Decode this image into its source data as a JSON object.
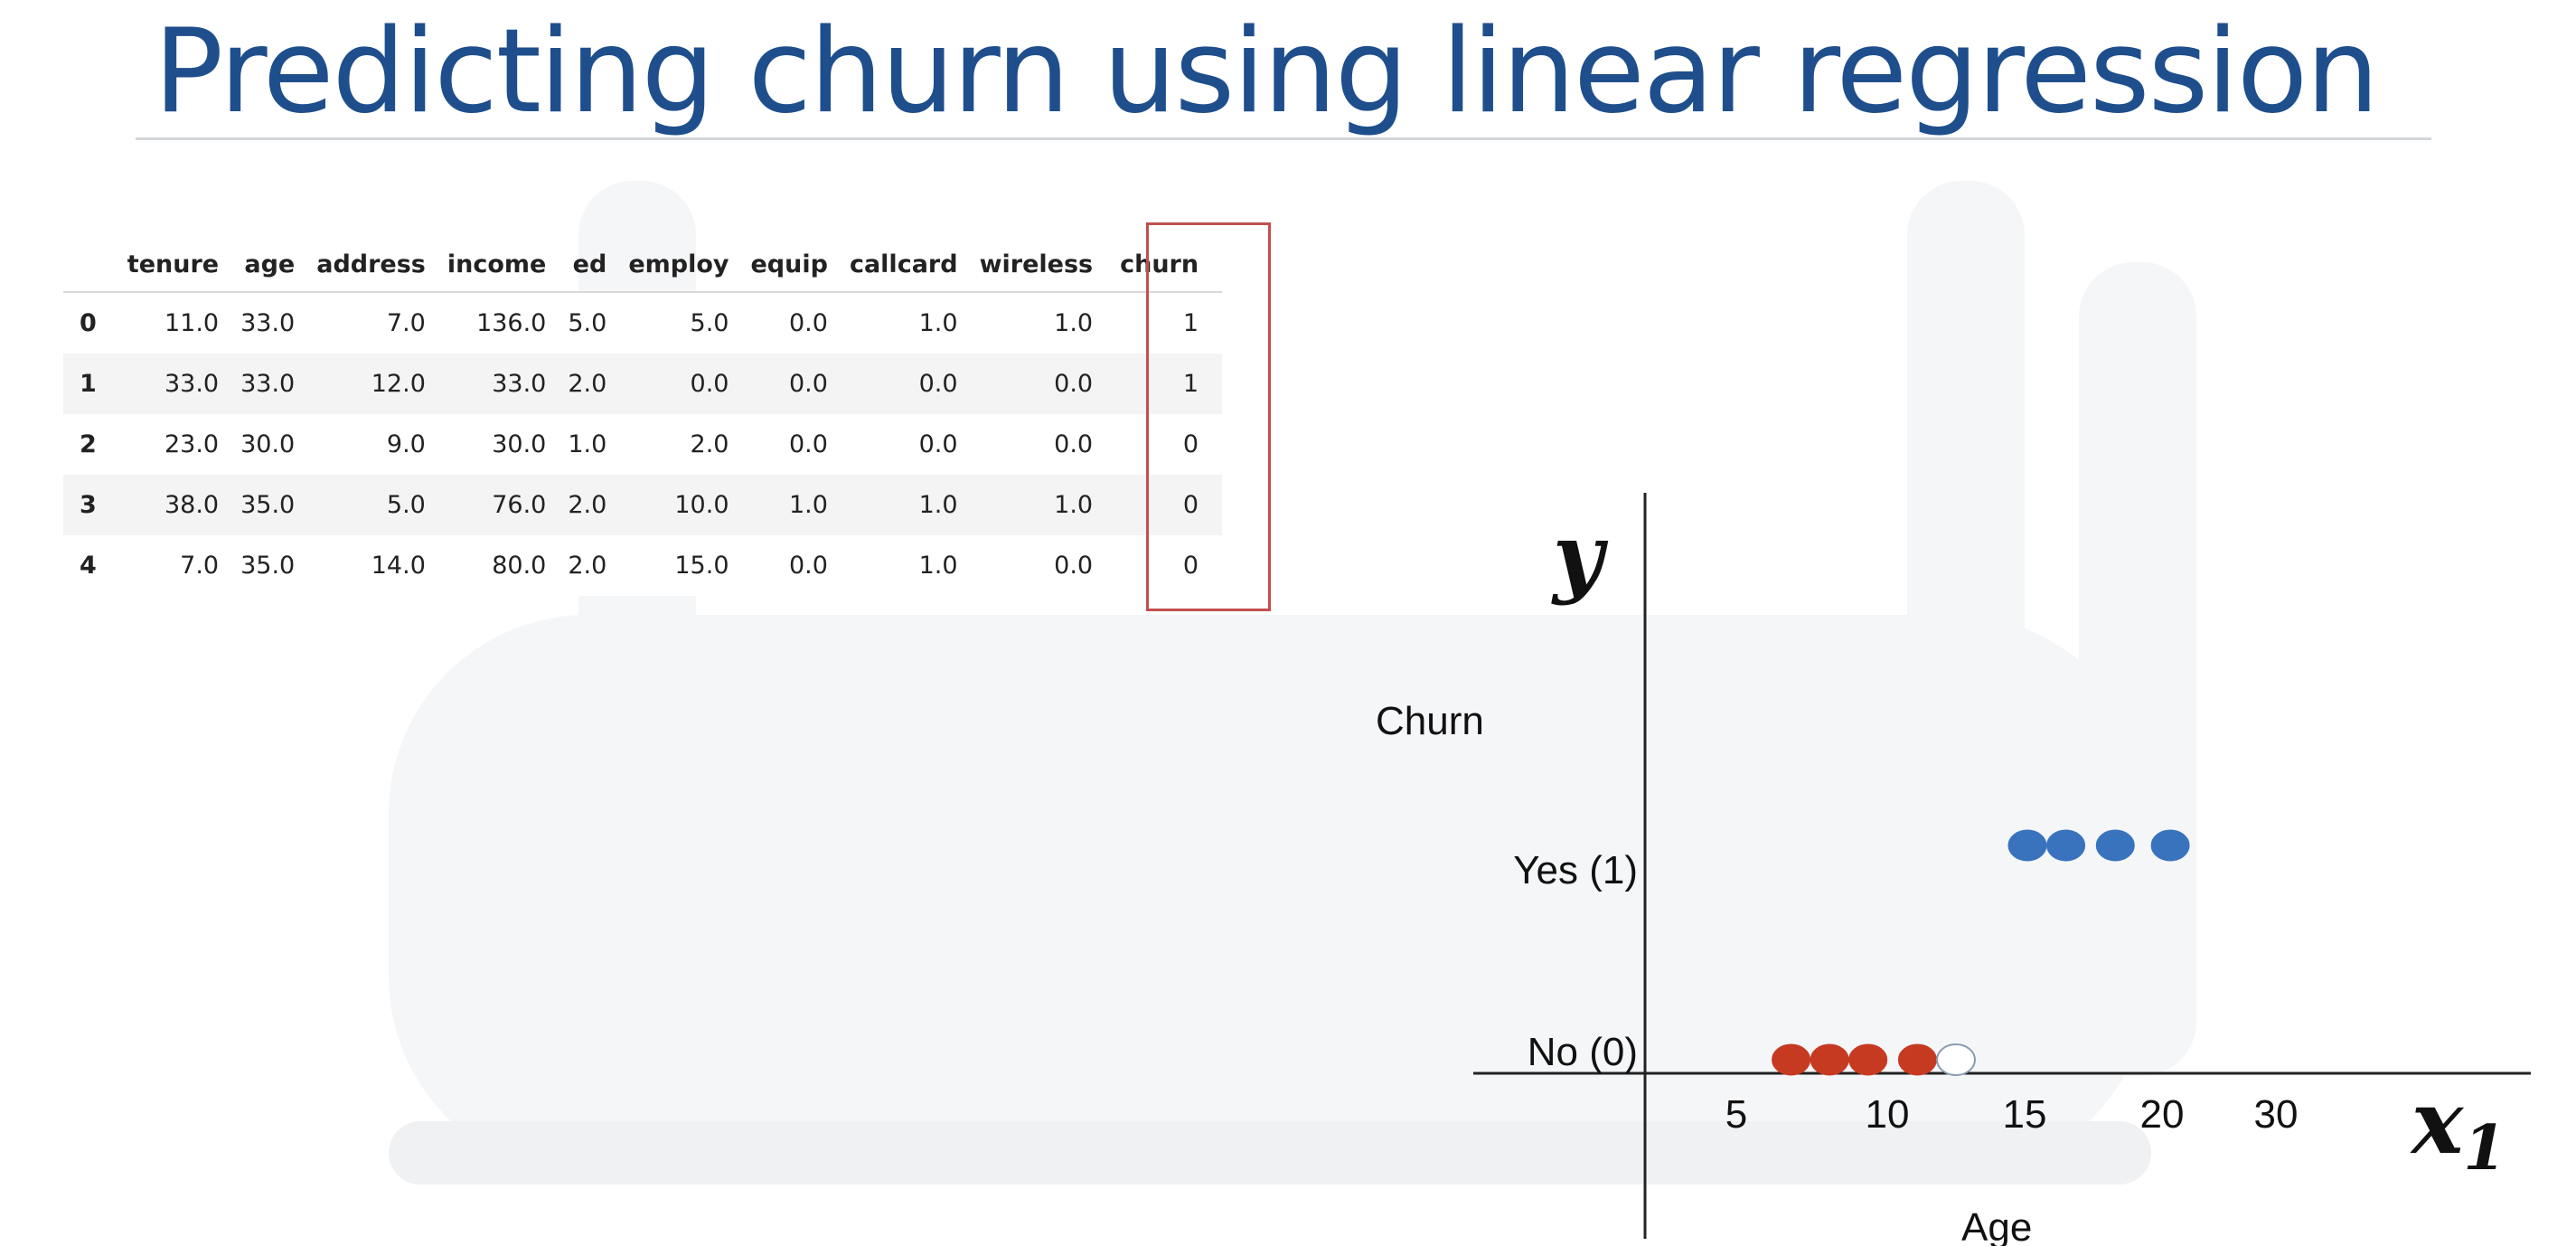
{
  "slide": {
    "title": "Predicting churn using linear regression"
  },
  "table": {
    "columns": [
      "",
      "tenure",
      "age",
      "address",
      "income",
      "ed",
      "employ",
      "equip",
      "callcard",
      "wireless",
      "churn"
    ],
    "rows": [
      [
        "0",
        "11.0",
        "33.0",
        "7.0",
        "136.0",
        "5.0",
        "5.0",
        "0.0",
        "1.0",
        "1.0",
        "1"
      ],
      [
        "1",
        "33.0",
        "33.0",
        "12.0",
        "33.0",
        "2.0",
        "0.0",
        "0.0",
        "0.0",
        "0.0",
        "1"
      ],
      [
        "2",
        "23.0",
        "30.0",
        "9.0",
        "30.0",
        "1.0",
        "2.0",
        "0.0",
        "0.0",
        "0.0",
        "0"
      ],
      [
        "3",
        "38.0",
        "35.0",
        "5.0",
        "76.0",
        "2.0",
        "10.0",
        "1.0",
        "1.0",
        "1.0",
        "0"
      ],
      [
        "4",
        "7.0",
        "35.0",
        "14.0",
        "80.0",
        "2.0",
        "15.0",
        "0.0",
        "1.0",
        "0.0",
        "0"
      ]
    ],
    "highlight_column": "churn",
    "highlight_color": "#c0504d"
  },
  "chart_data": {
    "type": "scatter",
    "ylabel": "Churn",
    "xlabel": "Age",
    "y_symbol": "y",
    "x_symbol": "x",
    "x_symbol_subscript": "1",
    "y_ticks": [
      "Yes (1)",
      "No (0)"
    ],
    "x_ticks": [
      "5",
      "10",
      "15",
      "20",
      "30"
    ],
    "series": [
      {
        "color": "#c63a22",
        "y": 0,
        "x": [
          6.5,
          7.9,
          9.3,
          11.1
        ]
      },
      {
        "color": "#ffffff",
        "y": 0,
        "x": [
          12.5
        ]
      },
      {
        "color": "#3a73bd",
        "y": 1,
        "x": [
          15.1,
          16.5,
          18.3,
          20.3
        ]
      }
    ]
  }
}
